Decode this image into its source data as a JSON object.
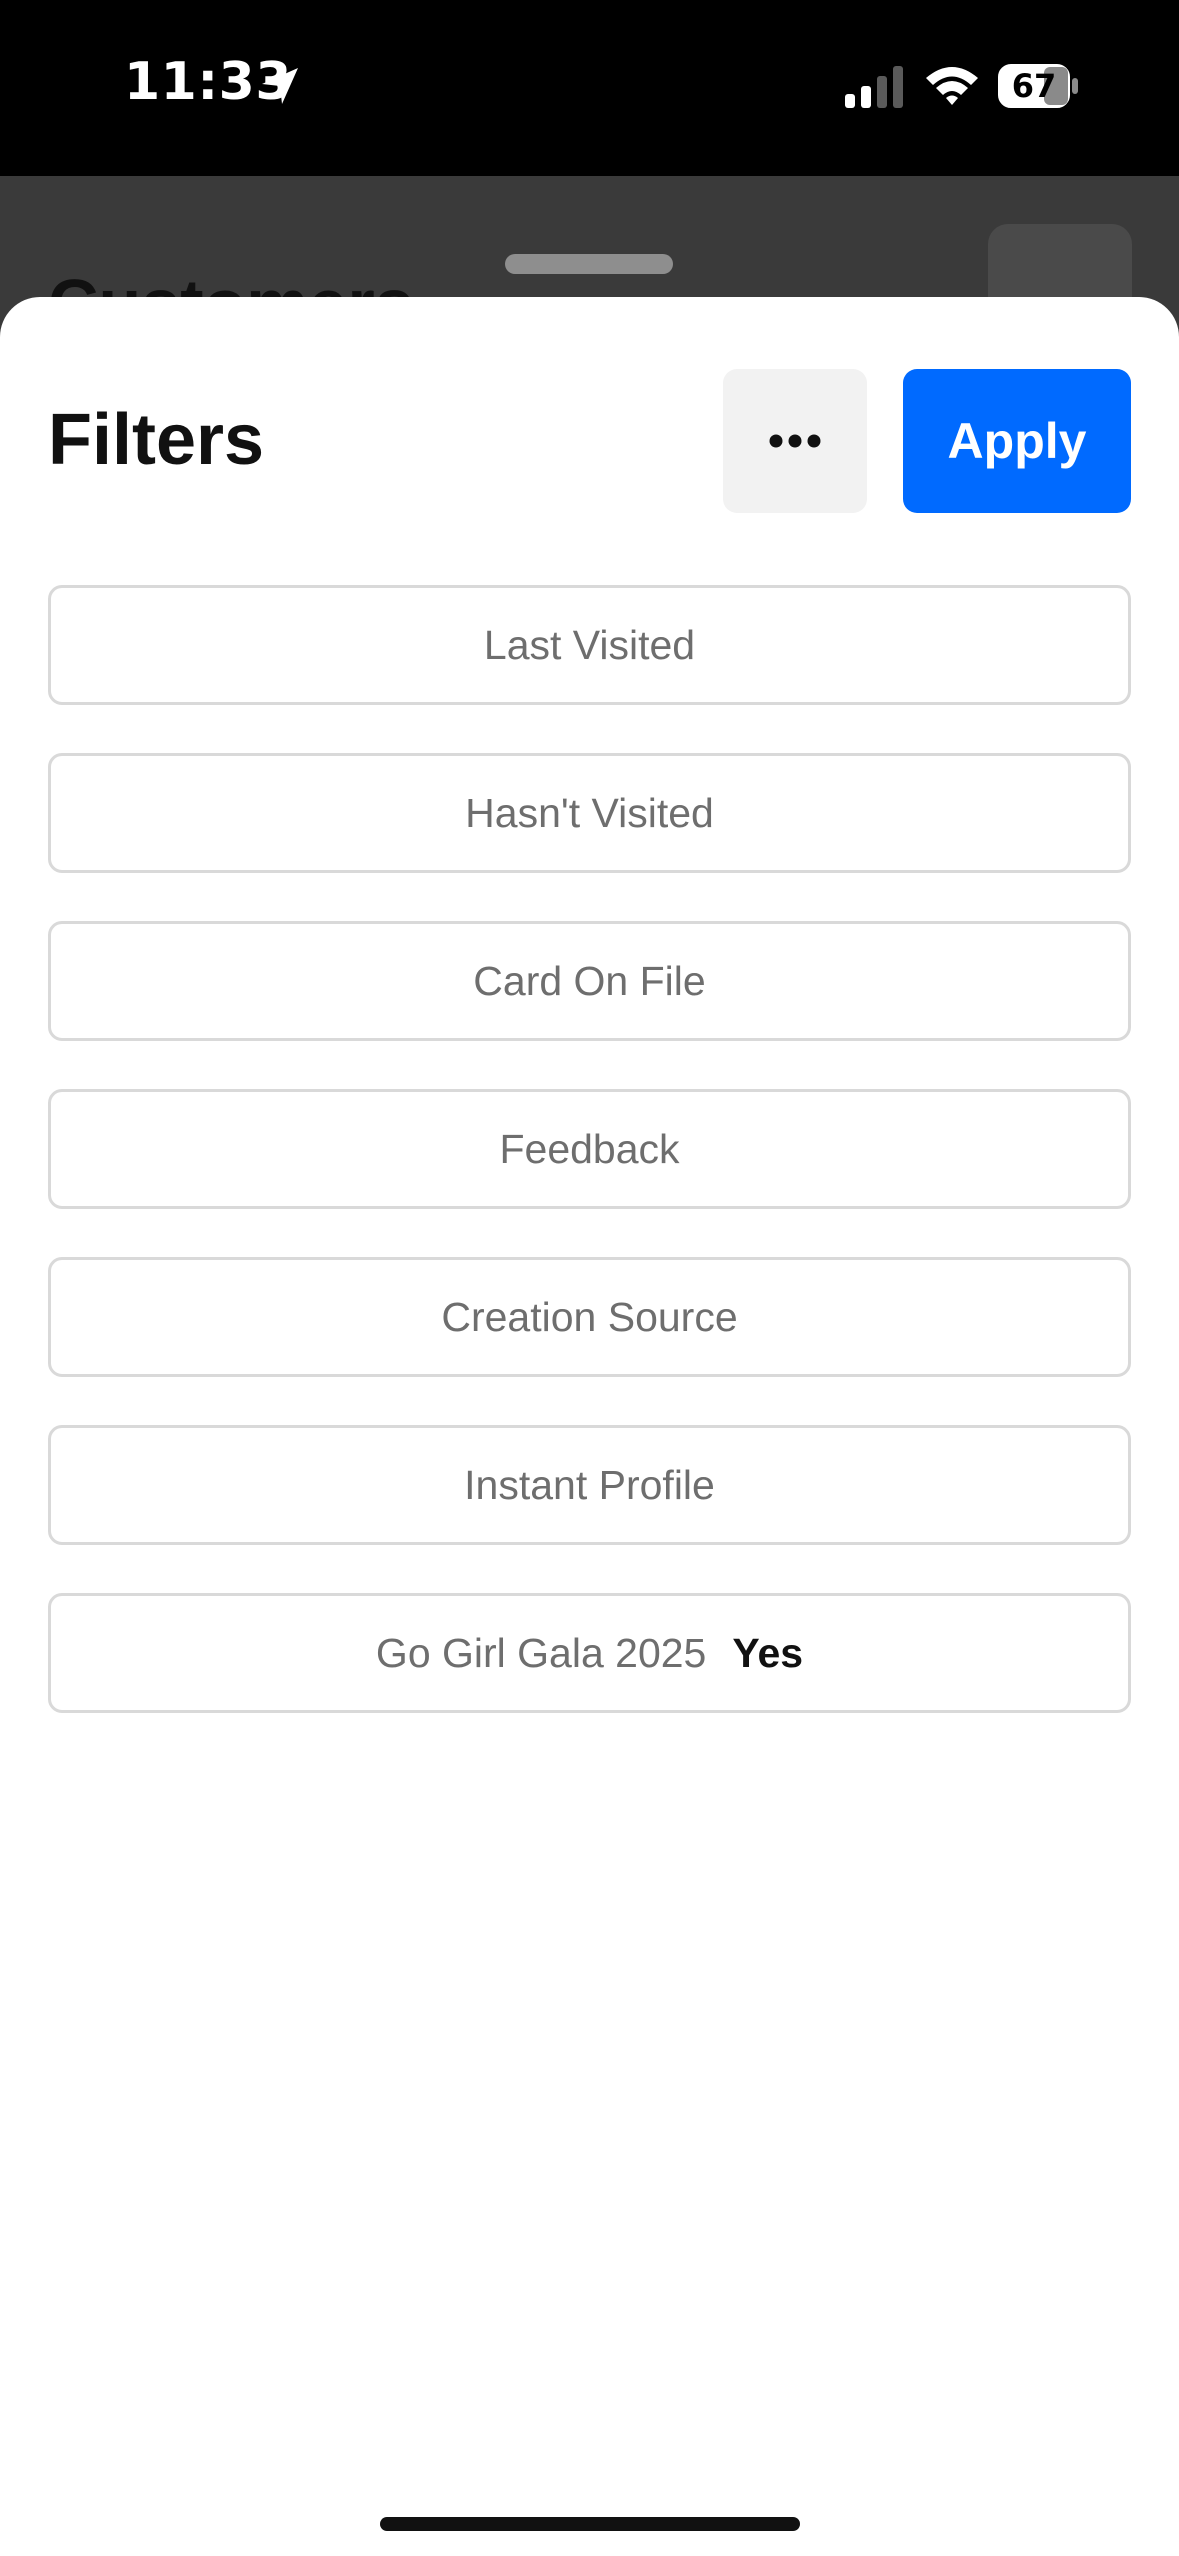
{
  "status_bar": {
    "time": "11:33",
    "battery": "67",
    "icons": [
      "location-arrow-icon",
      "cellular-signal-icon",
      "wifi-icon",
      "battery-icon"
    ]
  },
  "background": {
    "title": "Customers",
    "more_label": "•••"
  },
  "sheet": {
    "title": "Filters",
    "more_icon": "more-horizontal-icon",
    "apply_label": "Apply",
    "accent_color": "#006aff",
    "filters": [
      {
        "label": "Last Visited",
        "value": ""
      },
      {
        "label": "Hasn't Visited",
        "value": ""
      },
      {
        "label": "Card On File",
        "value": ""
      },
      {
        "label": "Feedback",
        "value": ""
      },
      {
        "label": "Creation Source",
        "value": ""
      },
      {
        "label": "Instant Profile",
        "value": ""
      },
      {
        "label": "Go Girl Gala 2025",
        "value": "Yes"
      }
    ]
  }
}
